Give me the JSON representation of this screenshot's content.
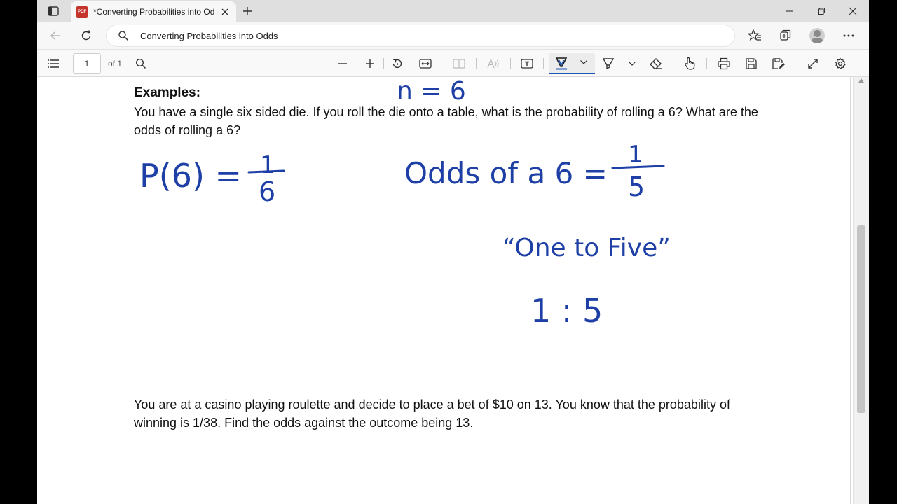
{
  "tab": {
    "title": "*Converting Probabilities into Odds",
    "favicon_label": "PDF"
  },
  "address": {
    "text": "Converting Probabilities into Odds"
  },
  "pdf_toolbar": {
    "page_number": "1",
    "page_of": "of 1"
  },
  "document": {
    "heading": "Examples:",
    "example1": "You have a single six sided die. If you roll the die onto a table, what is the probability of rolling a 6? What are the odds of rolling a 6?",
    "example2": "You are at a casino playing roulette and decide to place a bet of $10 on 13. You know that the probability of winning is 1/38. Find the odds against the outcome being 13."
  },
  "ink": {
    "n_label": "n = 6",
    "p_lhs": "P(6) =",
    "p_num": "1",
    "p_den": "6",
    "odds_lhs": "Odds of a 6 =",
    "odds_num": "1",
    "odds_den": "5",
    "odds_words": "“One to Five”",
    "ratio": "1 : 5",
    "color": "#1d3fa6"
  }
}
